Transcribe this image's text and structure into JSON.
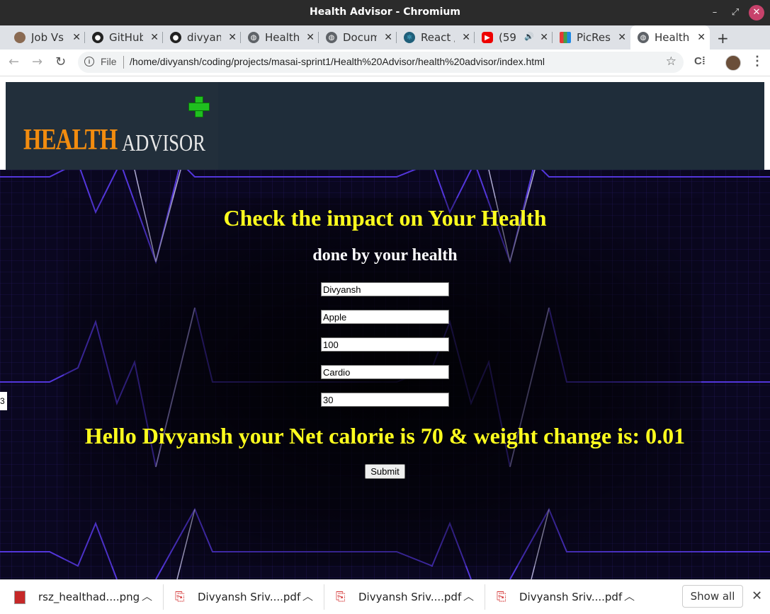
{
  "window": {
    "title": "Health Advisor - Chromium",
    "minimize": "–",
    "maximize": "⤢",
    "close": "✕"
  },
  "tabs": [
    {
      "label": "Job Vs",
      "icon": "avatar-favicon"
    },
    {
      "label": "GitHub",
      "icon": "github-icon"
    },
    {
      "label": "divyan",
      "icon": "github-icon"
    },
    {
      "label": "Health",
      "icon": "globe-icon"
    },
    {
      "label": "Docum",
      "icon": "globe-icon"
    },
    {
      "label": "React /",
      "icon": "react-icon"
    },
    {
      "label": "(59",
      "icon": "youtube-icon"
    },
    {
      "label": "PicRes",
      "icon": "picresize-icon"
    },
    {
      "label": "Health",
      "icon": "globe-icon",
      "active": true
    }
  ],
  "address": {
    "scheme": "File",
    "url": "/home/divyansh/coding/projects/masai-sprint1/Health%20Advisor/health%20advisor/index.html"
  },
  "logo": {
    "health": "HEALTH",
    "advisor": "ADVISOR"
  },
  "page": {
    "heading": "Check the impact on Your Health",
    "subheading": "done by your health",
    "fields": {
      "name": "Divyansh",
      "food": "Apple",
      "calories": "100",
      "exercise": "Cardio",
      "minutes": "30"
    },
    "result": "Hello Divyansh your Net calorie is 70 & weight change is: 0.01",
    "submit_label": "Submit",
    "edge_text": "3"
  },
  "downloads": [
    {
      "name": "rsz_healthad....png",
      "type": "png"
    },
    {
      "name": "Divyansh Sriv....pdf",
      "type": "pdf"
    },
    {
      "name": "Divyansh Sriv....pdf",
      "type": "pdf"
    },
    {
      "name": "Divyansh Sriv....pdf",
      "type": "pdf"
    }
  ],
  "shelf": {
    "show_all": "Show all",
    "close": "✕"
  },
  "colors": {
    "heading": "#ffff1e",
    "logo_orange": "#f28c0f",
    "plus_green": "#1fbf1f",
    "bg_purple": "#4b2bd6"
  }
}
